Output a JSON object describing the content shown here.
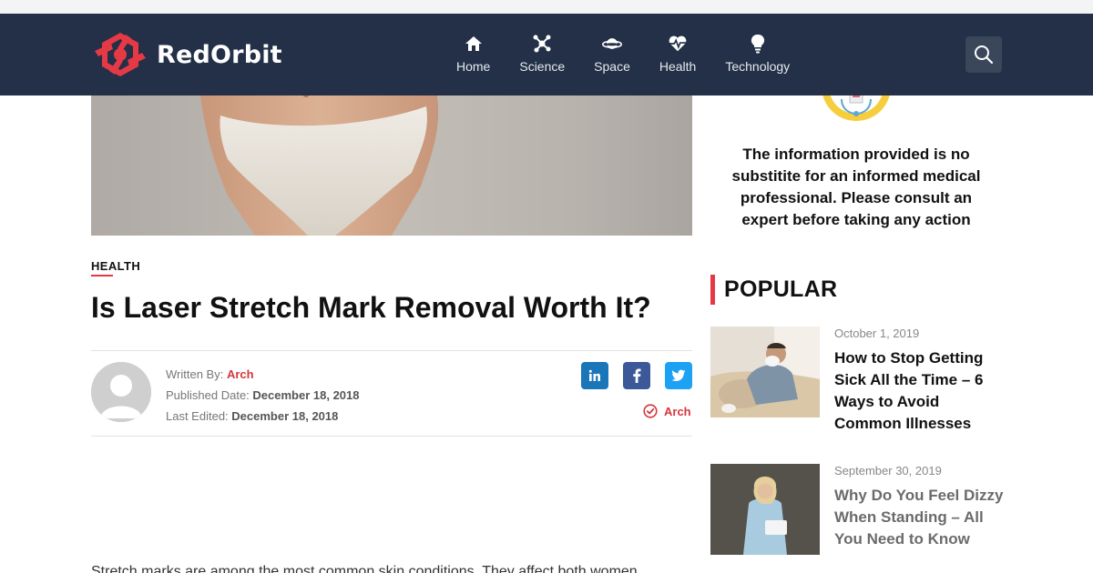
{
  "brand": {
    "name": "RedOrbit",
    "accent": "#e63946",
    "navbar_bg": "#233047"
  },
  "nav": {
    "items": [
      {
        "label": "Home",
        "icon": "home-icon"
      },
      {
        "label": "Science",
        "icon": "molecule-icon"
      },
      {
        "label": "Space",
        "icon": "planet-icon"
      },
      {
        "label": "Health",
        "icon": "heartbeat-icon"
      },
      {
        "label": "Technology",
        "icon": "lightbulb-icon"
      }
    ],
    "search_icon": "search-icon"
  },
  "article": {
    "category": "HEALTH",
    "title": "Is Laser Stretch Mark Removal Worth It?",
    "meta": {
      "written_by_label": "Written By:",
      "author": "Arch",
      "published_label": "Published Date:",
      "published_date": "December 18, 2018",
      "edited_label": "Last Edited:",
      "edited_date": "December 18, 2018"
    },
    "share": [
      "linkedin-icon",
      "facebook-icon",
      "twitter-icon"
    ],
    "fact_checker": "Arch",
    "body_start": "Stretch marks are among the most common skin conditions. They affect both women"
  },
  "sidebar": {
    "disclaimer": "The information provided is no substitite for an informed medical professional. Please consult an expert before taking any action",
    "popular_heading": "POPULAR",
    "posts": [
      {
        "date": "October 1, 2019",
        "title": "How to Stop Getting Sick All the Time – 6 Ways to Avoid Common Illnesses"
      },
      {
        "date": "September 30, 2019",
        "title": "Why Do You Feel Dizzy When Standing – All You Need to Know"
      }
    ]
  }
}
